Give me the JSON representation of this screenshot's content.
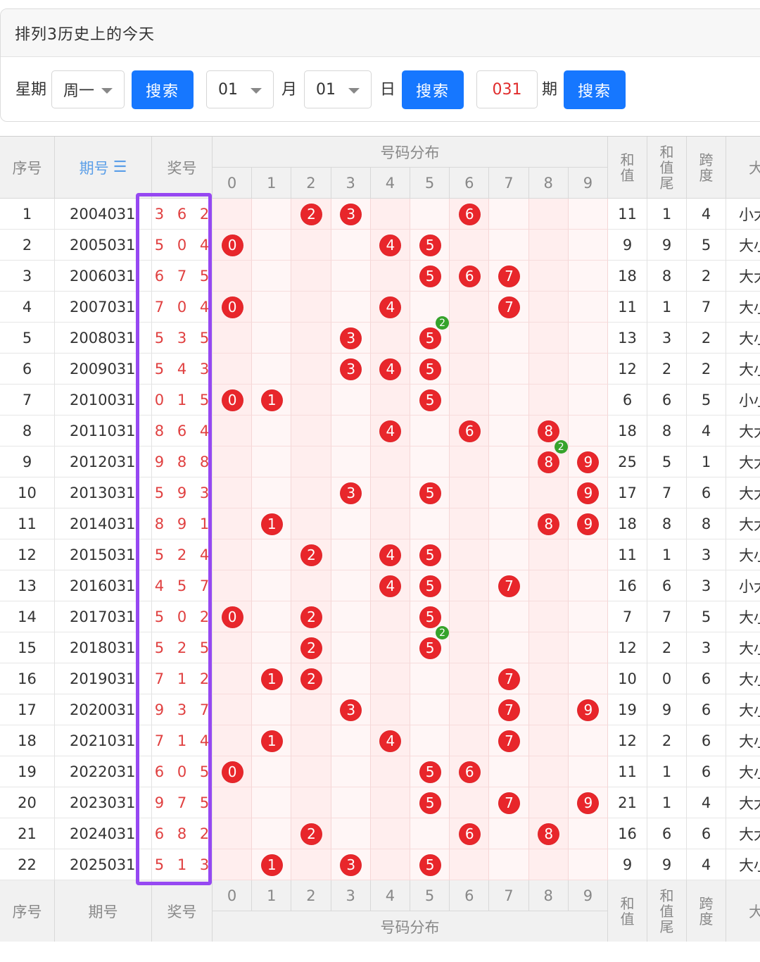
{
  "card": {
    "title": "排列3历史上的今天",
    "weekday_label": "星期",
    "weekday_value": "周一",
    "month_value": "01",
    "month_label": "月",
    "day_value": "01",
    "day_label": "日",
    "issue_value": "031",
    "issue_label": "期",
    "search_label": "搜索"
  },
  "table": {
    "headers": {
      "seq": "序号",
      "period": "期号",
      "prize": "奖号",
      "distribution": "号码分布",
      "sum": "和值",
      "sum_tail": "和值尾",
      "span": "跨度",
      "size_partial": "大"
    },
    "digits": [
      "0",
      "1",
      "2",
      "3",
      "4",
      "5",
      "6",
      "7",
      "8",
      "9"
    ],
    "rows": [
      {
        "seq": "1",
        "period": "2004031",
        "nums": [
          3,
          6,
          2
        ],
        "prize": "3 6 2",
        "sum": "11",
        "tail": "1",
        "span": "4",
        "size": "小大"
      },
      {
        "seq": "2",
        "period": "2005031",
        "nums": [
          5,
          0,
          4
        ],
        "prize": "5 0 4",
        "sum": "9",
        "tail": "9",
        "span": "5",
        "size": "大小"
      },
      {
        "seq": "3",
        "period": "2006031",
        "nums": [
          6,
          7,
          5
        ],
        "prize": "6 7 5",
        "sum": "18",
        "tail": "8",
        "span": "2",
        "size": "大大"
      },
      {
        "seq": "4",
        "period": "2007031",
        "nums": [
          7,
          0,
          4
        ],
        "prize": "7 0 4",
        "sum": "11",
        "tail": "1",
        "span": "7",
        "size": "大小"
      },
      {
        "seq": "5",
        "period": "2008031",
        "nums": [
          5,
          3,
          5
        ],
        "prize": "5 3 5",
        "sum": "13",
        "tail": "3",
        "span": "2",
        "size": "大小"
      },
      {
        "seq": "6",
        "period": "2009031",
        "nums": [
          5,
          4,
          3
        ],
        "prize": "5 4 3",
        "sum": "12",
        "tail": "2",
        "span": "2",
        "size": "大小"
      },
      {
        "seq": "7",
        "period": "2010031",
        "nums": [
          0,
          1,
          5
        ],
        "prize": "0 1 5",
        "sum": "6",
        "tail": "6",
        "span": "5",
        "size": "小小"
      },
      {
        "seq": "8",
        "period": "2011031",
        "nums": [
          8,
          6,
          4
        ],
        "prize": "8 6 4",
        "sum": "18",
        "tail": "8",
        "span": "4",
        "size": "大大"
      },
      {
        "seq": "9",
        "period": "2012031",
        "nums": [
          9,
          8,
          8
        ],
        "prize": "9 8 8",
        "sum": "25",
        "tail": "5",
        "span": "1",
        "size": "大大"
      },
      {
        "seq": "10",
        "period": "2013031",
        "nums": [
          5,
          9,
          3
        ],
        "prize": "5 9 3",
        "sum": "17",
        "tail": "7",
        "span": "6",
        "size": "大大"
      },
      {
        "seq": "11",
        "period": "2014031",
        "nums": [
          8,
          9,
          1
        ],
        "prize": "8 9 1",
        "sum": "18",
        "tail": "8",
        "span": "8",
        "size": "大大"
      },
      {
        "seq": "12",
        "period": "2015031",
        "nums": [
          5,
          2,
          4
        ],
        "prize": "5 2 4",
        "sum": "11",
        "tail": "1",
        "span": "3",
        "size": "大小"
      },
      {
        "seq": "13",
        "period": "2016031",
        "nums": [
          4,
          5,
          7
        ],
        "prize": "4 5 7",
        "sum": "16",
        "tail": "6",
        "span": "3",
        "size": "小大"
      },
      {
        "seq": "14",
        "period": "2017031",
        "nums": [
          5,
          0,
          2
        ],
        "prize": "5 0 2",
        "sum": "7",
        "tail": "7",
        "span": "5",
        "size": "大小"
      },
      {
        "seq": "15",
        "period": "2018031",
        "nums": [
          5,
          2,
          5
        ],
        "prize": "5 2 5",
        "sum": "12",
        "tail": "2",
        "span": "3",
        "size": "大小"
      },
      {
        "seq": "16",
        "period": "2019031",
        "nums": [
          7,
          1,
          2
        ],
        "prize": "7 1 2",
        "sum": "10",
        "tail": "0",
        "span": "6",
        "size": "大小"
      },
      {
        "seq": "17",
        "period": "2020031",
        "nums": [
          9,
          3,
          7
        ],
        "prize": "9 3 7",
        "sum": "19",
        "tail": "9",
        "span": "6",
        "size": "大小"
      },
      {
        "seq": "18",
        "period": "2021031",
        "nums": [
          7,
          1,
          4
        ],
        "prize": "7 1 4",
        "sum": "12",
        "tail": "2",
        "span": "6",
        "size": "大小"
      },
      {
        "seq": "19",
        "period": "2022031",
        "nums": [
          6,
          0,
          5
        ],
        "prize": "6 0 5",
        "sum": "11",
        "tail": "1",
        "span": "6",
        "size": "大小"
      },
      {
        "seq": "20",
        "period": "2023031",
        "nums": [
          9,
          7,
          5
        ],
        "prize": "9 7 5",
        "sum": "21",
        "tail": "1",
        "span": "4",
        "size": "大大"
      },
      {
        "seq": "21",
        "period": "2024031",
        "nums": [
          6,
          8,
          2
        ],
        "prize": "6 8 2",
        "sum": "16",
        "tail": "6",
        "span": "6",
        "size": "大大"
      },
      {
        "seq": "22",
        "period": "2025031",
        "nums": [
          5,
          1,
          3
        ],
        "prize": "5 1 3",
        "sum": "9",
        "tail": "9",
        "span": "4",
        "size": "大小"
      }
    ]
  }
}
